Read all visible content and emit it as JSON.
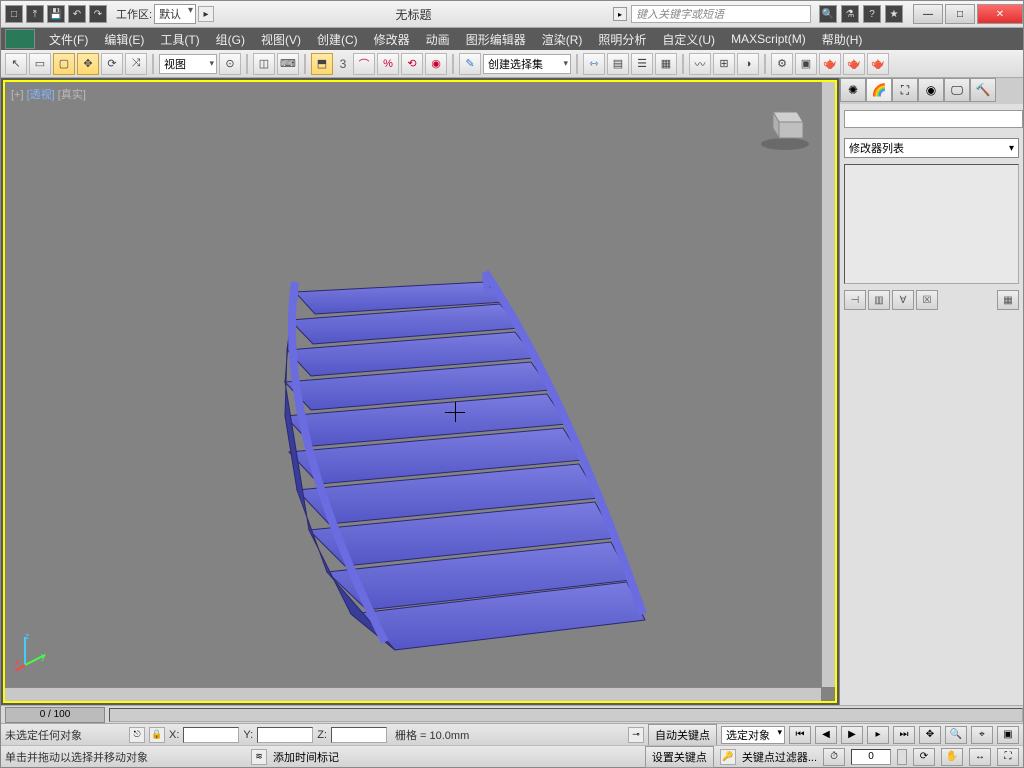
{
  "titlebar": {
    "workspace_label": "工作区:",
    "workspace_value": "默认",
    "title": "无标题",
    "search_placeholder": "键入关键字或短语"
  },
  "win_controls": {
    "min": "—",
    "max": "□",
    "close": "✕"
  },
  "menus": [
    "文件(F)",
    "编辑(E)",
    "工具(T)",
    "组(G)",
    "视图(V)",
    "创建(C)",
    "修改器",
    "动画",
    "图形编辑器",
    "渲染(R)",
    "照明分析",
    "自定义(U)",
    "MAXScript(M)",
    "帮助(H)"
  ],
  "toolbar": {
    "ref_coord": "视图",
    "named_sel": "创建选择集",
    "three": "3"
  },
  "viewport": {
    "label_plus": "[+]",
    "label_view": "[透视]",
    "label_shade": "[真实]"
  },
  "cmdpanel": {
    "mod_list": "修改器列表"
  },
  "timeline": {
    "slider": "0 / 100"
  },
  "status1": {
    "selection": "未选定任何对象",
    "x": "X:",
    "y": "Y:",
    "z": "Z:",
    "grid": "栅格 = 10.0mm",
    "autokey": "自动关键点",
    "selected": "选定对象"
  },
  "status2": {
    "prompt": "单击并拖动以选择并移动对象",
    "add_time_tag": "添加时间标记",
    "setkey": "设置关键点",
    "keyfilter": "关键点过滤器...",
    "frame": "0"
  }
}
